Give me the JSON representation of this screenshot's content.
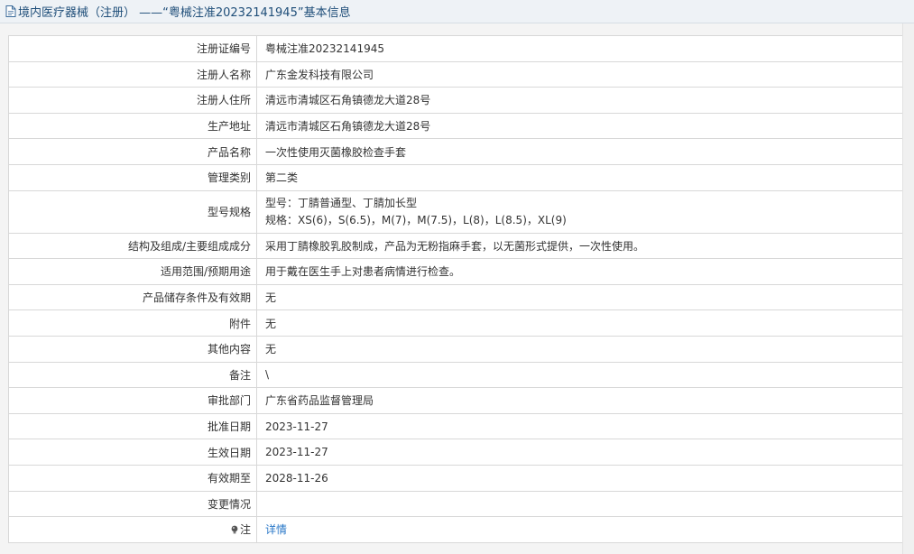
{
  "header": {
    "title": "境内医疗器械（注册） ——“粤械注准20232141945”基本信息"
  },
  "rows": [
    {
      "label": "注册证编号",
      "value": "粤械注准20232141945"
    },
    {
      "label": "注册人名称",
      "value": "广东金发科技有限公司"
    },
    {
      "label": "注册人住所",
      "value": "清远市清城区石角镇德龙大道28号"
    },
    {
      "label": "生产地址",
      "value": "清远市清城区石角镇德龙大道28号"
    },
    {
      "label": "产品名称",
      "value": "一次性使用灭菌橡胶检查手套"
    },
    {
      "label": "管理类别",
      "value": "第二类"
    },
    {
      "label": "型号规格",
      "value_line1": "型号：丁腈普通型、丁腈加长型",
      "value_line2": "规格：XS(6)，S(6.5)，M(7)，M(7.5)，L(8)，L(8.5)，XL(9)"
    },
    {
      "label": "结构及组成/主要组成成分",
      "value": "采用丁腈橡胶乳胶制成，产品为无粉指麻手套，以无菌形式提供，一次性使用。"
    },
    {
      "label": "适用范围/预期用途",
      "value": "用于戴在医生手上对患者病情进行检查。"
    },
    {
      "label": "产品储存条件及有效期",
      "value": "无"
    },
    {
      "label": "附件",
      "value": "无"
    },
    {
      "label": "其他内容",
      "value": "无"
    },
    {
      "label": "备注",
      "value": "\\"
    },
    {
      "label": "审批部门",
      "value": "广东省药品监督管理局"
    },
    {
      "label": "批准日期",
      "value": "2023-11-27"
    },
    {
      "label": "生效日期",
      "value": "2023-11-27"
    },
    {
      "label": "有效期至",
      "value": "2028-11-26"
    },
    {
      "label": "变更情况",
      "value": ""
    },
    {
      "label": "注",
      "value": "详情"
    }
  ],
  "icons": {
    "header_icon": "document-icon",
    "note_icon": "lightbulb-icon"
  },
  "colors": {
    "title_text": "#1f4e79",
    "link": "#2a78c8",
    "border": "#d8d8d8"
  }
}
